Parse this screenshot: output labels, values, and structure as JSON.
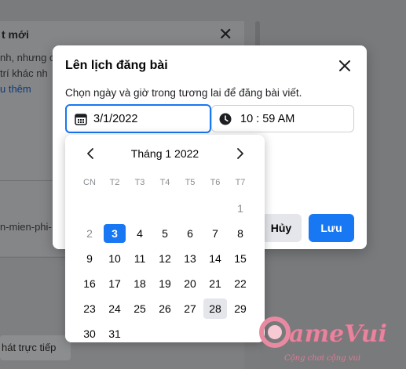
{
  "background": {
    "header_title": "t mới",
    "text_line_1": "nh, nhưng c",
    "text_line_2": "trí khác nh",
    "link_text": "u thêm",
    "url_fragment": "n-mien-phi-",
    "bottom_button": "hát trực tiếp"
  },
  "dialog": {
    "title": "Lên lịch đăng bài",
    "description": "Chọn ngày và giờ trong tương lai để đăng bài viết.",
    "date_value": "3/1/2022",
    "time_value": "10 : 59 AM",
    "cancel_label": "Hủy",
    "save_label": "Lưu"
  },
  "calendar": {
    "month_label": "Tháng 1 2022",
    "weekdays": [
      "CN",
      "T2",
      "T3",
      "T4",
      "T5",
      "T6",
      "T7"
    ],
    "weeks": [
      [
        "",
        "",
        "",
        "",
        "",
        "",
        "1"
      ],
      [
        "2",
        "3",
        "4",
        "5",
        "6",
        "7",
        "8"
      ],
      [
        "9",
        "10",
        "11",
        "12",
        "13",
        "14",
        "15"
      ],
      [
        "16",
        "17",
        "18",
        "19",
        "20",
        "21",
        "22"
      ],
      [
        "23",
        "24",
        "25",
        "26",
        "27",
        "28",
        "29"
      ],
      [
        "30",
        "31",
        "",
        "",
        "",
        "",
        ""
      ]
    ],
    "selected_day": "3",
    "hovered_day": "28",
    "muted_days": [
      "1",
      "2"
    ]
  },
  "watermark": {
    "logo_text": "GameVui",
    "slogan": "Cộng chơi cộng vui"
  },
  "colors": {
    "accent": "#1877f2",
    "muted_text": "#8a8d91",
    "button_gray": "#e4e6eb"
  }
}
